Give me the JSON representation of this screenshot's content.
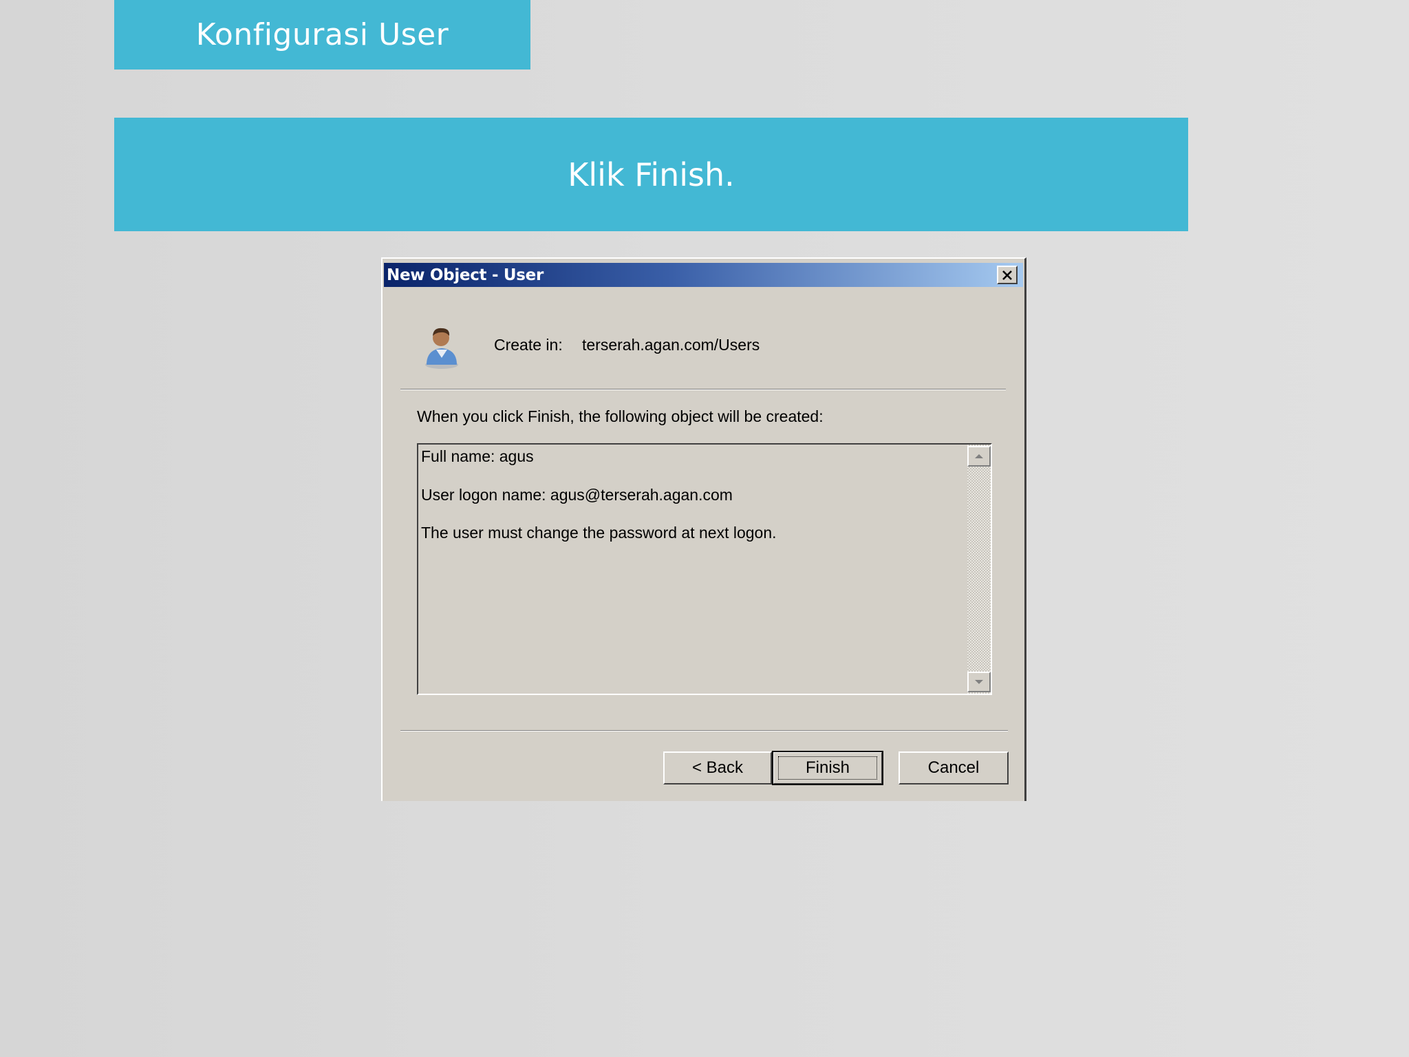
{
  "slide": {
    "title": "Konfigurasi User",
    "instruction": "Klik Finish.",
    "banner_color": "#43b8d4"
  },
  "dialog": {
    "title": "New Object - User",
    "close_icon": "close-icon",
    "user_icon": "user-icon",
    "create_in_label": "Create in:",
    "create_in_value": "terserah.agan.com/Users",
    "summary_heading": "When you click Finish, the following object will be created:",
    "summary_lines": [
      "Full name: agus",
      "User logon name: agus@terserah.agan.com",
      "The user must change the password at next logon."
    ],
    "buttons": {
      "back": "< Back",
      "finish": "Finish",
      "cancel": "Cancel"
    }
  }
}
